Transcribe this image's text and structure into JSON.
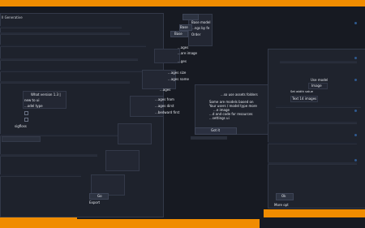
{
  "colors": {
    "accent": "#f08c00",
    "background": "#171a22",
    "panel": "#232733",
    "highlight": "#2f5a8f"
  },
  "top_left_menu": {
    "label": "Il Generative"
  },
  "dropdown": {
    "items": [
      "Base model",
      "...ngs by fe",
      "Order"
    ]
  },
  "small_buttons": {
    "upper_left": "Base",
    "upper_mid": "Base"
  },
  "settings": {
    "labels": [
      "...ages",
      "...are image",
      "...ges",
      "...ages size",
      "...ages name",
      "...ages",
      "...ages from",
      "...ages dirst",
      "...bedward first"
    ]
  },
  "version": {
    "title": "What version 1.3 |",
    "new_to_ui": "new to ui",
    "model_type": "...odel type"
  },
  "notice": {
    "title": "...so use assets folders",
    "bullets": [
      "Some are models based on",
      "Your users / model type more",
      "...e image",
      "...d and code for resources",
      "...settings ui"
    ]
  },
  "ok_label": "Got it",
  "right_panel": {
    "label_top": "Use model",
    "input_value": "Image",
    "tag": "Text 14 images",
    "field1": "Set width value"
  },
  "bottom": {
    "left_button": "Go",
    "left_label": "Export",
    "right_button": "Ok",
    "right_label": "More opt"
  }
}
